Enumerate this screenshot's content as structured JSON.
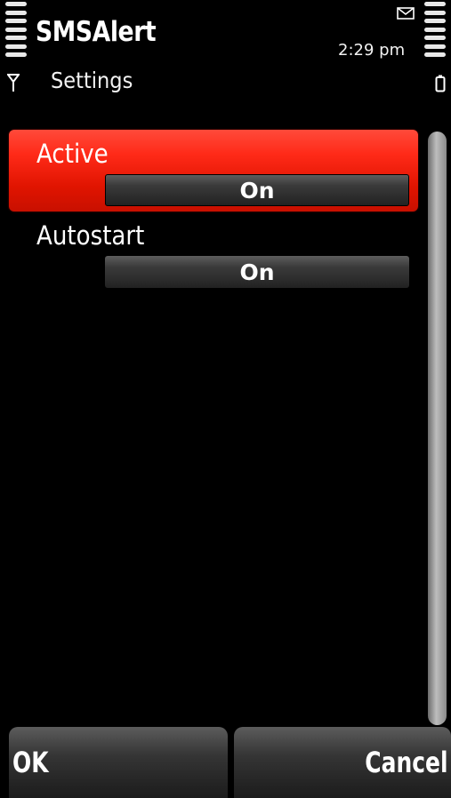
{
  "status": {
    "app_title": "SMSAlert",
    "subtitle": "Settings",
    "time": "2:29 pm",
    "indicators": {
      "signal": "signal-strength-icon",
      "battery": "battery-level-icon",
      "message": "envelope-icon",
      "network": "antenna-icon"
    }
  },
  "settings": [
    {
      "label": "Active",
      "value": "On",
      "highlighted": true
    },
    {
      "label": "Autostart",
      "value": "On",
      "highlighted": false
    }
  ],
  "softkeys": {
    "left": "OK",
    "right": "Cancel"
  },
  "colors": {
    "highlight": "#ff2a18",
    "background": "#000000"
  }
}
